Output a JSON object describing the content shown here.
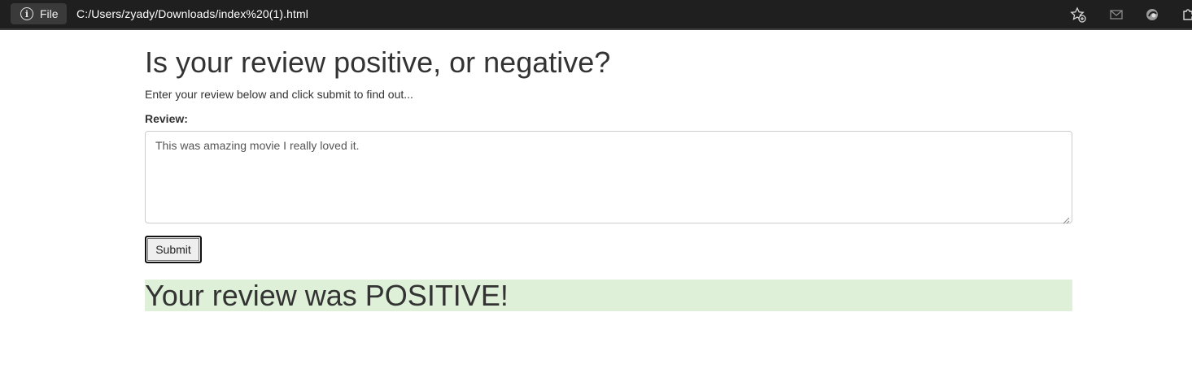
{
  "browser": {
    "site_info_label": "File",
    "url": "C:/Users/zyady/Downloads/index%20(1).html",
    "icons": [
      "info-icon",
      "favorites-icon",
      "mail-icon",
      "collections-icon",
      "extensions-icon"
    ]
  },
  "page": {
    "title": "Is your review positive, or negative?",
    "lead": "Enter your review below and click submit to find out...",
    "review_label": "Review:",
    "review_value": "This was amazing movie I really loved it.",
    "submit_label": "Submit",
    "result_text": "Your review was POSITIVE!"
  },
  "colors": {
    "browser_bar": "#1f1f1f",
    "result_background": "#dff0d8",
    "text": "#333333"
  }
}
